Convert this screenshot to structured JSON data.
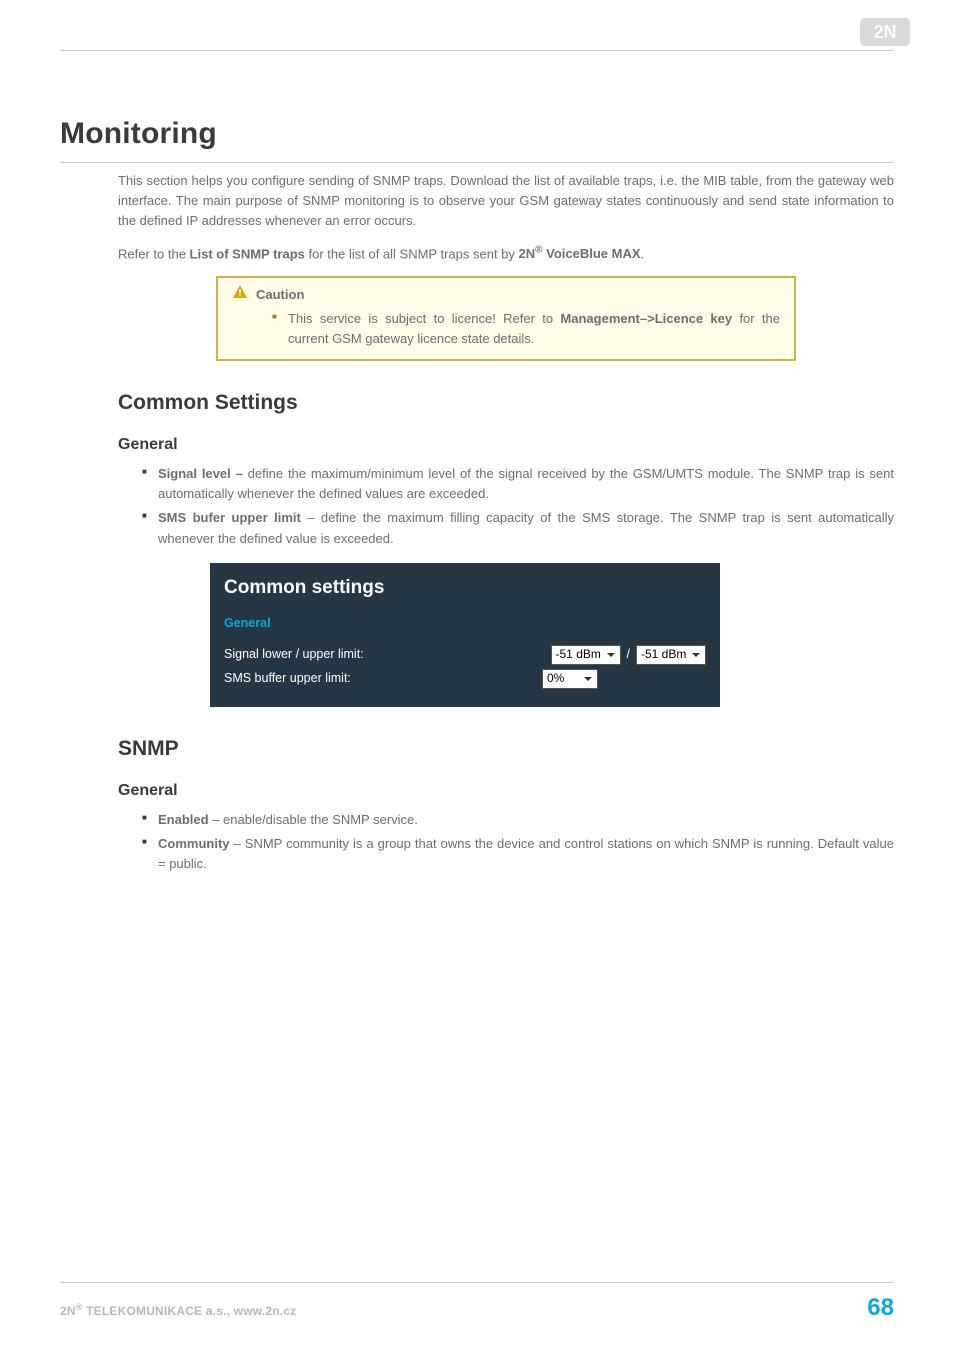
{
  "logo": {
    "name": "2n-logo"
  },
  "page": {
    "title": "Monitoring",
    "intro": "This section helps you configure sending of SNMP traps. Download the list of available traps, i.e. the MIB table, from the gateway web interface. The main purpose of SNMP monitoring is to observe your GSM gateway states continuously and send state information to the defined IP addresses whenever an error occurs.",
    "refer_prefix": "Refer to the ",
    "refer_bold1": "List of SNMP traps",
    "refer_mid": " for the list of all SNMP traps sent by ",
    "refer_bold2_pre": "2N",
    "refer_bold2_sup": "®",
    "refer_bold2_post": " VoiceBlue MAX",
    "refer_suffix": "."
  },
  "caution": {
    "title": "Caution",
    "item_pre": "This service is subject to licence! Refer to ",
    "item_bold": "Management–>Licence key",
    "item_post": " for the current GSM gateway licence state details."
  },
  "common": {
    "heading": "Common Settings",
    "general": "General",
    "bullet1_bold": "Signal level –",
    "bullet1_text": " define the maximum/minimum level of the signal received by the GSM/UMTS module. The SNMP trap is sent automatically whenever the defined values are exceeded.",
    "bullet2_bold": "SMS bufer upper limit",
    "bullet2_text": " – define the maximum filling capacity of the SMS storage. The SNMP trap is sent automatically whenever the defined value is exceeded."
  },
  "panel": {
    "title": "Common settings",
    "subtitle": "General",
    "row1_label": "Signal lower / upper limit:",
    "row1_val1": "-51 dBm",
    "row1_val2": "-51 dBm",
    "row2_label": "SMS buffer upper limit:",
    "row2_val": "0%"
  },
  "snmp": {
    "heading": "SNMP",
    "general": "General",
    "bullet1_bold": "Enabled",
    "bullet1_text": " – enable/disable the SNMP service.",
    "bullet2_bold": "Community",
    "bullet2_text": " –  SNMP community is a group that owns the device and control stations on which SNMP is running. Default value = public."
  },
  "footer": {
    "left_pre": "2N",
    "left_sup": "®",
    "left_post": " TELEKOMUNIKACE a.s., www.2n.cz",
    "page_no": "68"
  }
}
